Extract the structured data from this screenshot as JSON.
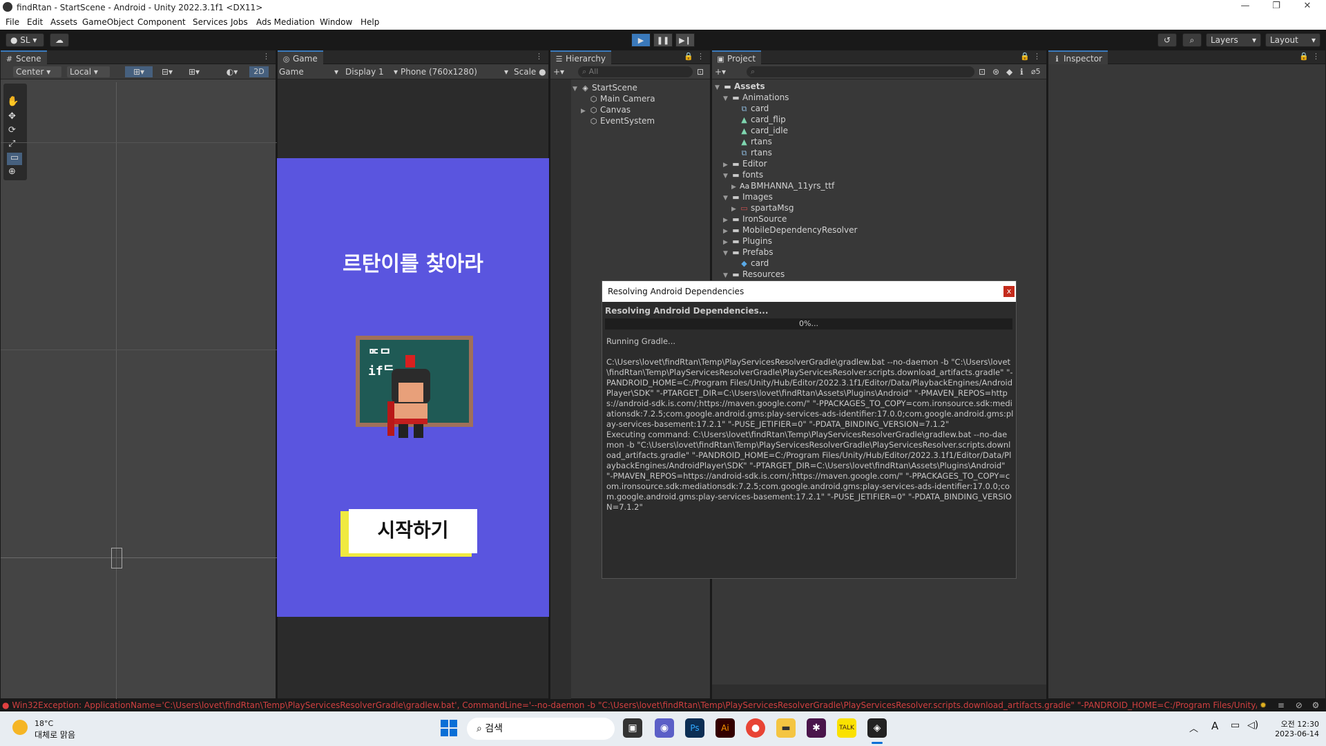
{
  "window": {
    "title": "findRtan - StartScene - Android - Unity 2022.3.1f1 <DX11>",
    "minimize": "—",
    "restore": "❐",
    "close": "✕"
  },
  "menu": [
    "File",
    "Edit",
    "Assets",
    "GameObject",
    "Component",
    "Services",
    "Jobs",
    "Ads Mediation",
    "Window",
    "Help"
  ],
  "toolbar": {
    "account": "SL",
    "layers": "Layers",
    "layout": "Layout"
  },
  "scene": {
    "tab": "Scene",
    "pivot": "Center",
    "space": "Local",
    "mode2d": "2D"
  },
  "game": {
    "tab": "Game",
    "view_select": "Game",
    "display": "Display 1",
    "resolution": "Phone (760x1280)",
    "scale": "Scale"
  },
  "game_screen": {
    "title": "르탄이를 찾아라",
    "start_button": "시작하기",
    "bg_color": "#5a55df"
  },
  "hierarchy": {
    "tab": "Hierarchy",
    "search_placeholder": "All",
    "scene": "StartScene",
    "items": [
      "Main Camera",
      "Canvas",
      "EventSystem"
    ]
  },
  "project": {
    "tab": "Project",
    "hidden_count": "5",
    "root": "Assets",
    "items": [
      {
        "label": "Animations",
        "depth": 1,
        "arrow": "▼",
        "icon": "folder"
      },
      {
        "label": "card",
        "depth": 2,
        "arrow": "",
        "icon": "anim-controller"
      },
      {
        "label": "card_flip",
        "depth": 2,
        "arrow": "",
        "icon": "anim-clip"
      },
      {
        "label": "card_idle",
        "depth": 2,
        "arrow": "",
        "icon": "anim-clip"
      },
      {
        "label": "rtans",
        "depth": 2,
        "arrow": "",
        "icon": "anim-clip"
      },
      {
        "label": "rtans",
        "depth": 2,
        "arrow": "",
        "icon": "anim-controller"
      },
      {
        "label": "Editor",
        "depth": 1,
        "arrow": "▶",
        "icon": "folder"
      },
      {
        "label": "fonts",
        "depth": 1,
        "arrow": "▼",
        "icon": "folder"
      },
      {
        "label": "BMHANNA_11yrs_ttf",
        "depth": 2,
        "arrow": "▶",
        "icon": "font"
      },
      {
        "label": "Images",
        "depth": 1,
        "arrow": "▼",
        "icon": "folder"
      },
      {
        "label": "spartaMsg",
        "depth": 2,
        "arrow": "▶",
        "icon": "sprite"
      },
      {
        "label": "IronSource",
        "depth": 1,
        "arrow": "▶",
        "icon": "folder"
      },
      {
        "label": "MobileDependencyResolver",
        "depth": 1,
        "arrow": "▶",
        "icon": "folder"
      },
      {
        "label": "Plugins",
        "depth": 1,
        "arrow": "▶",
        "icon": "folder"
      },
      {
        "label": "Prefabs",
        "depth": 1,
        "arrow": "▼",
        "icon": "folder"
      },
      {
        "label": "card",
        "depth": 2,
        "arrow": "",
        "icon": "prefab"
      },
      {
        "label": "Resources",
        "depth": 1,
        "arrow": "▼",
        "icon": "folder"
      }
    ]
  },
  "inspector": {
    "tab": "Inspector"
  },
  "dialog": {
    "title": "Resolving Android Dependencies",
    "close": "x",
    "heading": "Resolving Android Dependencies...",
    "progress_text": "0%...",
    "progress": 0,
    "log": "Running Gradle...\n\nC:\\Users\\lovet\\findRtan\\Temp\\PlayServicesResolverGradle\\gradlew.bat --no-daemon -b \"C:\\Users\\lovet\\findRtan\\Temp\\PlayServicesResolverGradle\\PlayServicesResolver.scripts.download_artifacts.gradle\" \"-PANDROID_HOME=C:/Program Files/Unity/Hub/Editor/2022.3.1f1/Editor/Data/PlaybackEngines/AndroidPlayer\\SDK\" \"-PTARGET_DIR=C:\\Users\\lovet\\findRtan\\Assets\\Plugins\\Android\" \"-PMAVEN_REPOS=https://android-sdk.is.com/;https://maven.google.com/\" \"-PPACKAGES_TO_COPY=com.ironsource.sdk:mediationsdk:7.2.5;com.google.android.gms:play-services-ads-identifier:17.0.0;com.google.android.gms:play-services-basement:17.2.1\" \"-PUSE_JETIFIER=0\" \"-PDATA_BINDING_VERSION=7.1.2\"\nExecuting command: C:\\Users\\lovet\\findRtan\\Temp\\PlayServicesResolverGradle\\gradlew.bat --no-daemon -b \"C:\\Users\\lovet\\findRtan\\Temp\\PlayServicesResolverGradle\\PlayServicesResolver.scripts.download_artifacts.gradle\" \"-PANDROID_HOME=C:/Program Files/Unity/Hub/Editor/2022.3.1f1/Editor/Data/PlaybackEngines/AndroidPlayer\\SDK\" \"-PTARGET_DIR=C:\\Users\\lovet\\findRtan\\Assets\\Plugins\\Android\" \"-PMAVEN_REPOS=https://android-sdk.is.com/;https://maven.google.com/\" \"-PPACKAGES_TO_COPY=com.ironsource.sdk:mediationsdk:7.2.5;com.google.android.gms:play-services-ads-identifier:17.0.0;com.google.android.gms:play-services-basement:17.2.1\" \"-PUSE_JETIFIER=0\" \"-PDATA_BINDING_VERSION=7.1.2\""
  },
  "console_error": "Win32Exception: ApplicationName='C:\\Users\\lovet\\findRtan\\Temp\\PlayServicesResolverGradle\\gradlew.bat', CommandLine='--no-daemon -b \"C:\\Users\\lovet\\findRtan\\Temp\\PlayServicesResolverGradle\\PlayServicesResolver.scripts.download_artifacts.gradle\" \"-PANDROID_HOME=C:/Program Files/Unity/Hub/Editor",
  "taskbar": {
    "weather_temp": "18°C",
    "weather_desc": "대체로 맑음",
    "search": "검색",
    "time": "오전 12:30",
    "date": "2023-06-14",
    "ime": "A"
  }
}
